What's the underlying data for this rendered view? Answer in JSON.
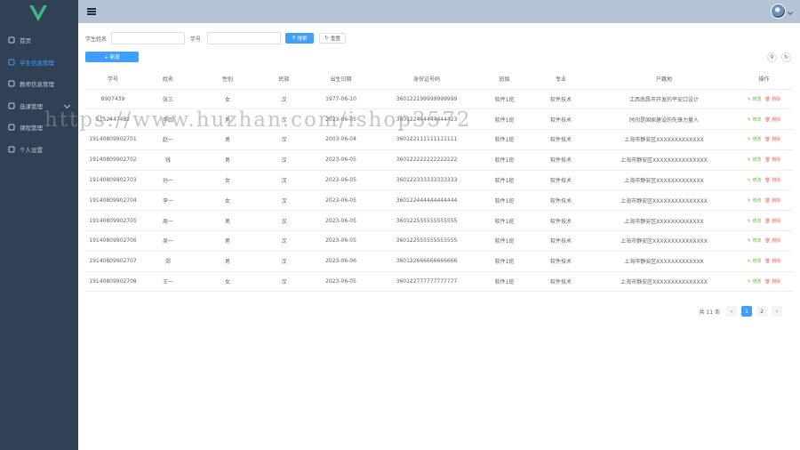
{
  "sidebar": {
    "items": [
      {
        "label": "首页",
        "icon": "dashboard-icon"
      },
      {
        "label": "学生信息管理",
        "icon": "user-icon"
      },
      {
        "label": "教师信息管理",
        "icon": "person-icon"
      },
      {
        "label": "选课管理",
        "icon": "list-icon",
        "has_children": true
      },
      {
        "label": "课程管理",
        "icon": "book-icon"
      },
      {
        "label": "个人设置",
        "icon": "settings-icon"
      }
    ],
    "active_index": 1,
    "accent": "#409eff"
  },
  "search": {
    "name_label": "学生姓名",
    "number_label": "学号",
    "search_button": "搜索",
    "reset_button": "重置"
  },
  "toolbar": {
    "add_button": "+ 新增"
  },
  "table": {
    "columns": [
      "学号",
      "姓名",
      "性别",
      "民族",
      "出生日期",
      "身份证号码",
      "班级",
      "专业",
      "户籍地",
      "操作"
    ],
    "rows": [
      [
        "8907439",
        "张三",
        "女",
        "汉",
        "1977-06-10",
        "360122199999999999",
        "软件1班",
        "软件技术",
        "江西南昌市开发的平安口设计"
      ],
      [
        "5152447482",
        "李四",
        "男",
        "汉",
        "2023-06-05",
        "360122444444444423",
        "软件1班",
        "软件技术",
        "时间是国家建设的先锋力量人"
      ],
      [
        "19140809902701",
        "赵一",
        "男",
        "汉",
        "2003-06-04",
        "360122111111111111",
        "软件1班",
        "软件技术",
        "上海市静安区XXXXXXXXXXXXX"
      ],
      [
        "19140809902702",
        "钱",
        "男",
        "汉",
        "2023-06-05",
        "360122222222222222",
        "软件1班",
        "软件技术",
        "上海市静安区XXXXXXXXXXXXXXX"
      ],
      [
        "19140809902703",
        "孙一",
        "女",
        "汉",
        "2023-06-05",
        "360122333333333333",
        "软件1班",
        "软件技术",
        "上海市静安区XXXXXXXXXXXXX"
      ],
      [
        "19140809902704",
        "李一",
        "女",
        "汉",
        "2023-06-05",
        "360122444444444444",
        "软件1班",
        "软件技术",
        "上海市静安区XXXXXXXXXXXXXXX"
      ],
      [
        "19140809902705",
        "周一",
        "男",
        "汉",
        "2023-06-05",
        "360122555555555555",
        "软件1班",
        "软件技术",
        "上海市静安区XXXXXXXXXXXXX"
      ],
      [
        "19140809902706",
        "吴一",
        "男",
        "汉",
        "2023-06-05",
        "360122555555555555",
        "软件1班",
        "软件技术",
        "上海市静安区XXXXXXXXXXXXXXX"
      ],
      [
        "19140809902707",
        "郑",
        "男",
        "汉",
        "2023-06-06",
        "360122666666666666",
        "软件1班",
        "软件技术",
        "上海市静安区XXXXXXXXXXXXX"
      ],
      [
        "19140809902708",
        "王一",
        "女",
        "汉",
        "2023-06-05",
        "360122777777777777",
        "软件1班",
        "软件技术",
        "上海市静安区XXXXXXXXXXXXXXX"
      ]
    ],
    "edit_label": "修改",
    "delete_label": "删除"
  },
  "pagination": {
    "total_text": "共 11 条",
    "pages": [
      "1",
      "2"
    ],
    "current": "1"
  },
  "watermark": "https://www.huzhan.com/ishop3572"
}
